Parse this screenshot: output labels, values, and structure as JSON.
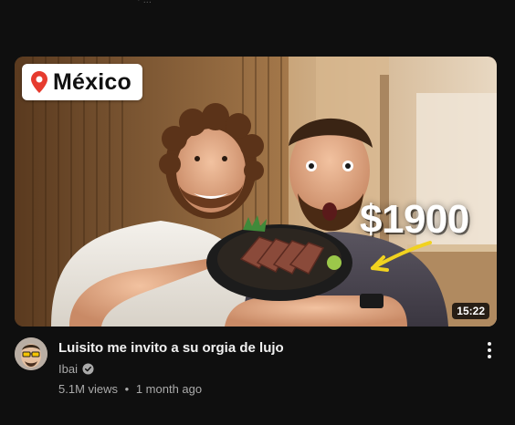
{
  "top_fragment": "· ...",
  "video": {
    "thumbnail": {
      "location_badge": "México",
      "price_overlay": "$1900",
      "duration": "15:22",
      "pin_color": "#e63b2e"
    },
    "title": "Luisito me invito a su orgia de lujo",
    "channel": "Ibai",
    "verified": true,
    "views": "5.1M views",
    "separator": "•",
    "age": "1 month ago"
  },
  "icons": {
    "location": "map-pin-icon",
    "verified": "verified-check-icon",
    "more": "more-vertical-icon"
  }
}
